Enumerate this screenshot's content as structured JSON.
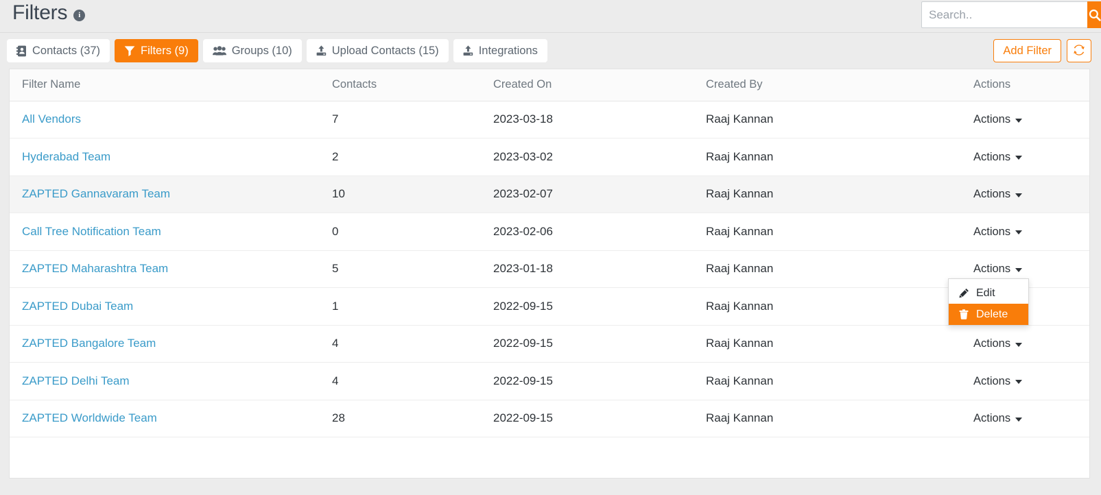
{
  "header": {
    "title": "Filters",
    "info_icon": "info-circle-icon"
  },
  "search": {
    "placeholder": "Search..",
    "value": "",
    "button_icon": "search-icon"
  },
  "tabs": [
    {
      "label": "Contacts (37)",
      "icon": "address-book-icon",
      "active": false
    },
    {
      "label": "Filters (9)",
      "icon": "filter-funnel-icon",
      "active": true
    },
    {
      "label": "Groups (10)",
      "icon": "users-icon",
      "active": false
    },
    {
      "label": "Upload Contacts (15)",
      "icon": "upload-icon",
      "active": false
    },
    {
      "label": "Integrations",
      "icon": "upload-icon",
      "active": false
    }
  ],
  "toolbar": {
    "add_filter_label": "Add Filter",
    "refresh_icon": "refresh-sync-icon"
  },
  "table": {
    "columns": [
      "Filter Name",
      "Contacts",
      "Created On",
      "Created By",
      "Actions"
    ],
    "actions_label": "Actions",
    "rows": [
      {
        "name": "All Vendors",
        "contacts": "7",
        "created_on": "2023-03-18",
        "created_by": "Raaj Kannan"
      },
      {
        "name": "Hyderabad Team",
        "contacts": "2",
        "created_on": "2023-03-02",
        "created_by": "Raaj Kannan"
      },
      {
        "name": "ZAPTED Gannavaram Team",
        "contacts": "10",
        "created_on": "2023-02-07",
        "created_by": "Raaj Kannan"
      },
      {
        "name": "Call Tree Notification Team",
        "contacts": "0",
        "created_on": "2023-02-06",
        "created_by": "Raaj Kannan"
      },
      {
        "name": "ZAPTED Maharashtra Team",
        "contacts": "5",
        "created_on": "2023-01-18",
        "created_by": "Raaj Kannan"
      },
      {
        "name": "ZAPTED Dubai Team",
        "contacts": "1",
        "created_on": "2022-09-15",
        "created_by": "Raaj Kannan"
      },
      {
        "name": "ZAPTED Bangalore Team",
        "contacts": "4",
        "created_on": "2022-09-15",
        "created_by": "Raaj Kannan"
      },
      {
        "name": "ZAPTED Delhi Team",
        "contacts": "4",
        "created_on": "2022-09-15",
        "created_by": "Raaj Kannan"
      },
      {
        "name": "ZAPTED Worldwide Team",
        "contacts": "28",
        "created_on": "2022-09-15",
        "created_by": "Raaj Kannan"
      }
    ]
  },
  "dropdown": {
    "open_for_row_index": 2,
    "items": [
      {
        "label": "Edit",
        "icon": "pencil-icon",
        "variant": "default"
      },
      {
        "label": "Delete",
        "icon": "trash-icon",
        "variant": "danger"
      }
    ]
  },
  "colors": {
    "accent": "#f97d0a",
    "link": "#3a9bc9",
    "page_bg": "#ececec",
    "title": "#3a4450",
    "row_alt": "#f5f5f5"
  }
}
